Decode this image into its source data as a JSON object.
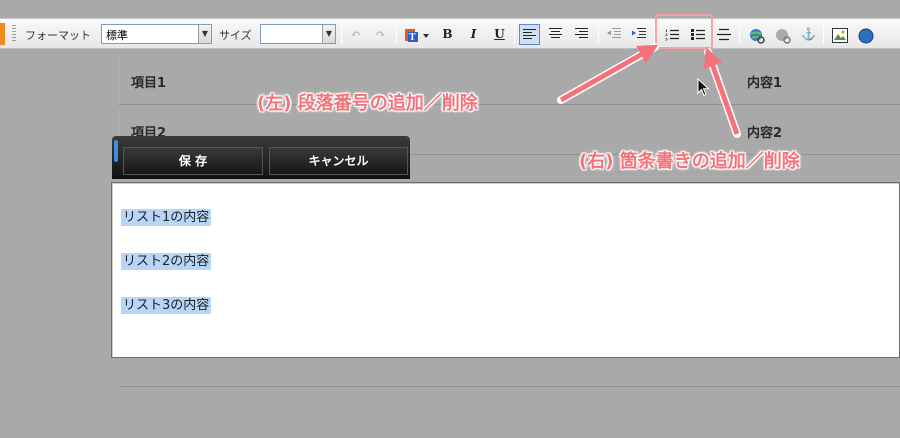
{
  "toolbar": {
    "format_label": "フォーマット",
    "format_value": "標準",
    "size_label": "サイズ",
    "size_value": "",
    "bold": "B",
    "italic": "I",
    "underline": "U"
  },
  "table": {
    "rows": [
      {
        "label": "項目1",
        "value": "内容1"
      },
      {
        "label": "項目2",
        "value": "内容2"
      }
    ]
  },
  "actions": {
    "save_label": "保 存",
    "cancel_label": "キャンセル"
  },
  "editor": {
    "lines": [
      "リスト1の内容",
      "リスト2の内容",
      "リスト3の内容"
    ]
  },
  "annotations": {
    "left": "(左) 段落番号の追加／削除",
    "right": "(右) 箇条書きの追加／削除"
  },
  "colors": {
    "annotation": "#f4737b",
    "selection": "#b7d6f7",
    "accent": "#f08a1c"
  }
}
